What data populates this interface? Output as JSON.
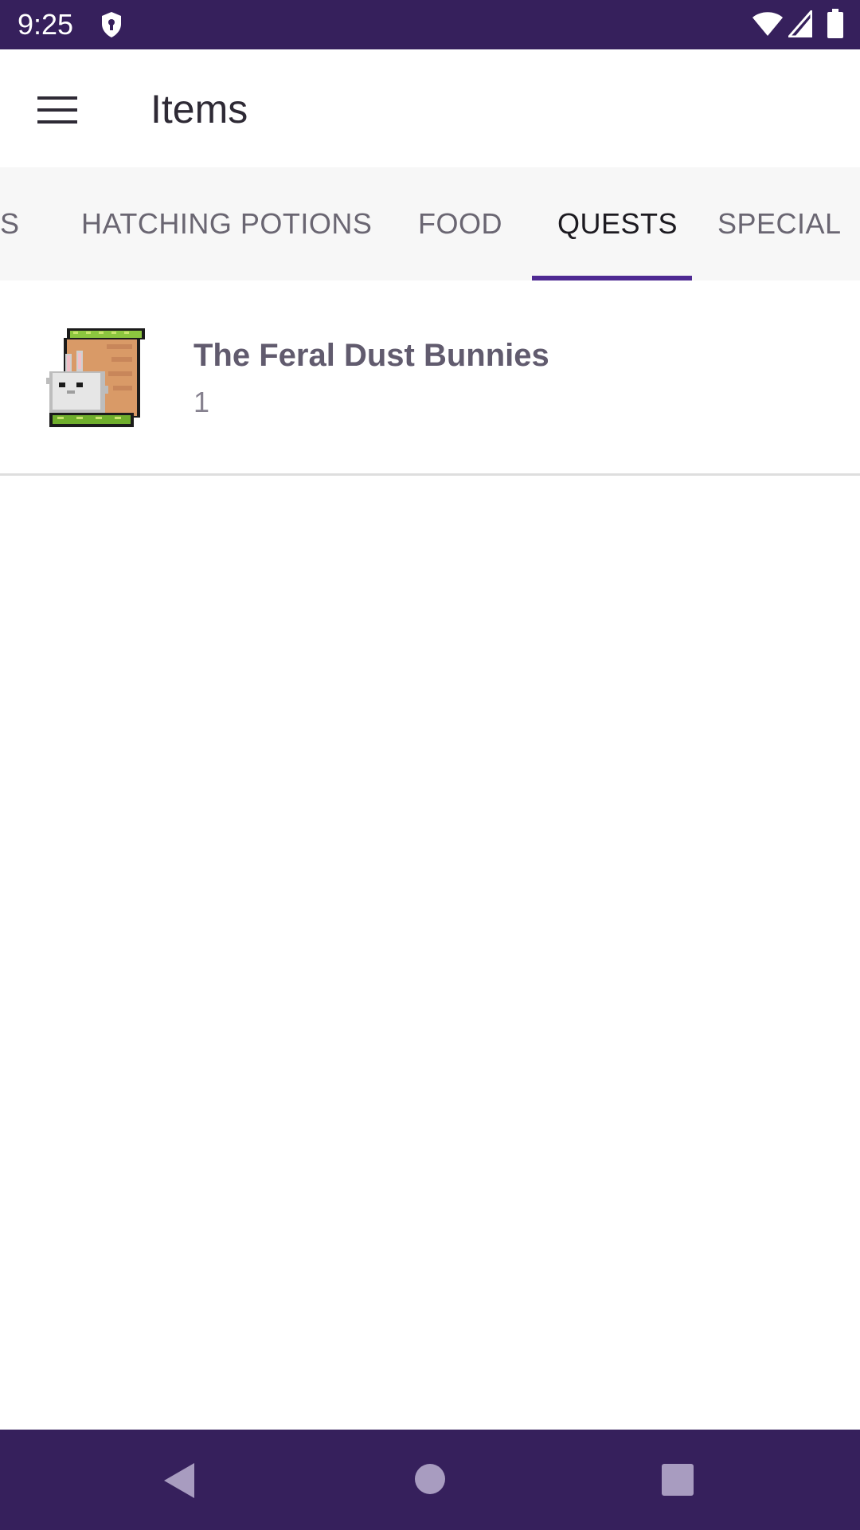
{
  "status_bar": {
    "time": "9:25",
    "icons": [
      "shield-icon",
      "wifi-icon",
      "signal-icon",
      "battery-icon"
    ]
  },
  "app_bar": {
    "menu_icon": "hamburger-menu-icon",
    "title": "Items"
  },
  "tabs": [
    {
      "label": "S",
      "active": false
    },
    {
      "label": "HATCHING POTIONS",
      "active": false
    },
    {
      "label": "FOOD",
      "active": false
    },
    {
      "label": "QUESTS",
      "active": true
    },
    {
      "label": "SPECIAL",
      "active": false
    }
  ],
  "items": [
    {
      "title": "The Feral Dust Bunnies",
      "count": "1",
      "image": "quest-scroll-bunny-image"
    }
  ],
  "nav_bar": {
    "icons": [
      "back-icon",
      "home-icon",
      "recents-icon"
    ]
  },
  "colors": {
    "primary": "#36205c",
    "tab_indicator": "#4f2a93",
    "item_title": "#615b6e"
  }
}
